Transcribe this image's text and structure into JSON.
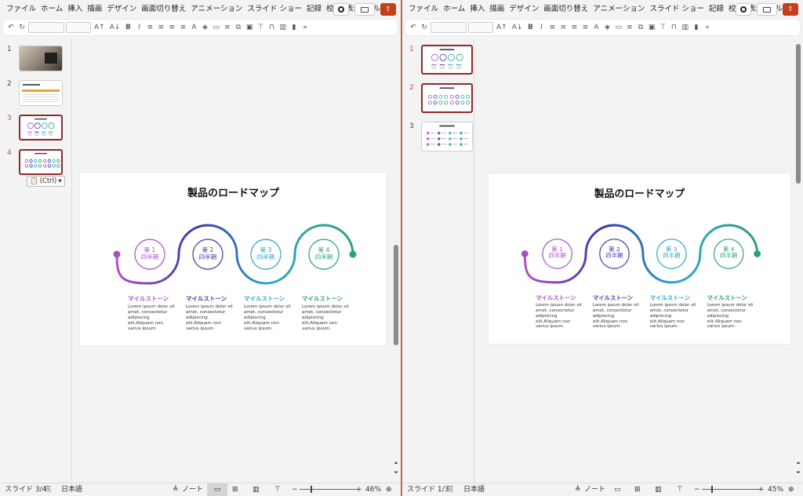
{
  "tabs": [
    "ファイル",
    "ホーム",
    "挿入",
    "描画",
    "デザイン",
    "画面切り替え",
    "アニメーション",
    "スライド ショー",
    "記録",
    "校閲",
    "表示",
    "ヘルプ"
  ],
  "ribbon_icons": [
    "undo-icon",
    "redo-icon",
    "font-grow",
    "font-shrink",
    "bold",
    "italic",
    "align-left",
    "align-center",
    "align-right",
    "justify",
    "font-color",
    "highlight",
    "shape-fill",
    "line-style",
    "arrange",
    "more"
  ],
  "slide": {
    "title": "製品のロードマップ",
    "quarters": [
      {
        "num": "第 1",
        "label": "四半期",
        "color": "#a94fc4"
      },
      {
        "num": "第 2",
        "label": "四半期",
        "color": "#3a3aa8"
      },
      {
        "num": "第 3",
        "label": "四半期",
        "color": "#2aa3c9"
      },
      {
        "num": "第 4",
        "label": "四半期",
        "color": "#2e9e78"
      }
    ],
    "milestone": "マイルストーン",
    "lorem": [
      "Lorem ipsum dolor sit",
      "amet, consectetur",
      "adipiscing",
      "elit.Aliquam non",
      "varius ipsum."
    ]
  },
  "left": {
    "thumb_numbers": [
      "1",
      "2",
      "3",
      "4"
    ],
    "paste_label": "(Ctrl)",
    "status_slide": "スライド 3/4",
    "status_lang": "日本語",
    "status_notes": "ノート",
    "zoom": "46%"
  },
  "right": {
    "thumb_numbers": [
      "1",
      "2",
      "3"
    ],
    "status_slide": "スライド 1/3",
    "status_lang": "日本語",
    "status_notes": "ノート",
    "zoom": "45%"
  },
  "colors": {
    "accent": "#c43e1c",
    "selected_border": "#8a2b2b"
  }
}
